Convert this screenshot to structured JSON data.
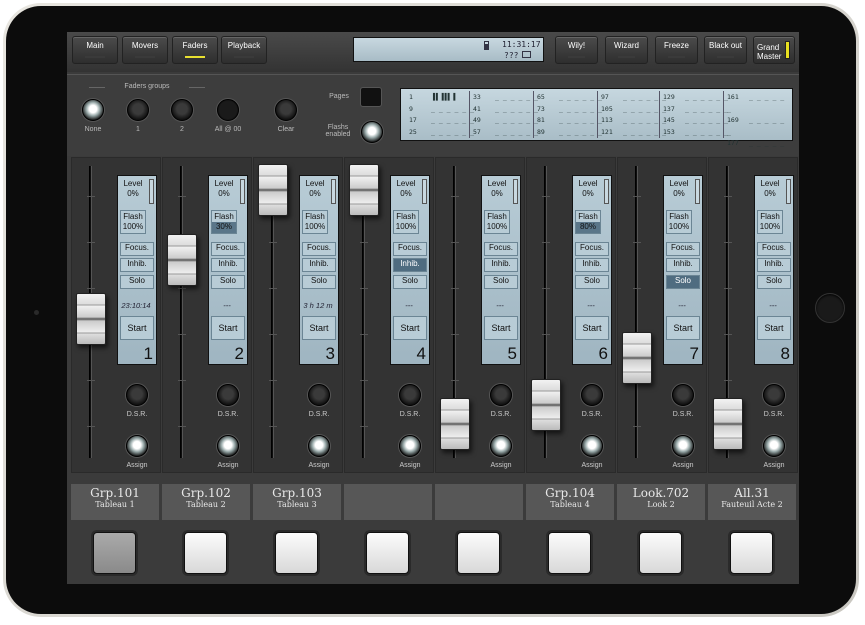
{
  "top_bar": {
    "buttons": [
      {
        "label": "Main",
        "active": false
      },
      {
        "label": "Movers",
        "active": false
      },
      {
        "label": "Faders",
        "active": true
      },
      {
        "label": "Playback",
        "active": false
      }
    ],
    "right_buttons": [
      "Wily!",
      "Wizard",
      "Freeze",
      "Black out"
    ],
    "grand_master": "Grand Master",
    "lcd": {
      "time": "11:31:17",
      "status": "???"
    }
  },
  "faders_groups": {
    "title": "Faders groups",
    "buttons": [
      {
        "label": "None",
        "lit": true
      },
      {
        "label": "1",
        "lit": false
      },
      {
        "label": "2",
        "lit": false
      },
      {
        "label": "All @ 00",
        "lit": false
      },
      {
        "label": "Clear",
        "lit": false
      }
    ],
    "pages_label": "Pages",
    "flashs_label": "Flashs enabled"
  },
  "pages_table": [
    [
      "1",
      "9",
      "17",
      "25"
    ],
    [
      "33",
      "41",
      "49",
      "57"
    ],
    [
      "65",
      "73",
      "81",
      "89"
    ],
    [
      "97",
      "105",
      "113",
      "121"
    ],
    [
      "129",
      "137",
      "145",
      "153"
    ],
    [
      "161",
      "169",
      "177",
      "185"
    ]
  ],
  "channels": [
    {
      "number": "1",
      "level_label": "Level",
      "level": "0%",
      "flash_label": "Flash",
      "flash": "100%",
      "focus": "Focus.",
      "inhib": "Inhib.",
      "solo": "Solo",
      "time": "23:10:14",
      "start": "Start",
      "dsr": "D.S.R.",
      "assign": "Assign",
      "fader_level": 0.45,
      "name": "Grp.101",
      "sub": "Tableau 1",
      "inhib_on": false,
      "solo_on": false
    },
    {
      "number": "2",
      "level_label": "Level",
      "level": "0%",
      "flash_label": "Flash",
      "flash": "30%",
      "focus": "Focus.",
      "inhib": "Inhib.",
      "solo": "Solo",
      "time": "---",
      "start": "Start",
      "dsr": "D.S.R.",
      "assign": "Assign",
      "fader_level": 0.7,
      "name": "Grp.102",
      "sub": "Tableau 2",
      "inhib_on": false,
      "solo_on": false
    },
    {
      "number": "3",
      "level_label": "Level",
      "level": "0%",
      "flash_label": "Flash",
      "flash": "100%",
      "focus": "Focus.",
      "inhib": "Inhib.",
      "solo": "Solo",
      "time": "3 h 12 m",
      "start": "Start",
      "dsr": "D.S.R.",
      "assign": "Assign",
      "fader_level": 1.0,
      "name": "Grp.103",
      "sub": "Tableau 3",
      "inhib_on": false,
      "solo_on": false
    },
    {
      "number": "4",
      "level_label": "Level",
      "level": "0%",
      "flash_label": "Flash",
      "flash": "100%",
      "focus": "Focus.",
      "inhib": "Inhib.",
      "solo": "Solo",
      "time": "---",
      "start": "Start",
      "dsr": "D.S.R.",
      "assign": "Assign",
      "fader_level": 1.0,
      "name": "",
      "sub": "",
      "inhib_on": true,
      "solo_on": false
    },
    {
      "number": "5",
      "level_label": "Level",
      "level": "0%",
      "flash_label": "Flash",
      "flash": "100%",
      "focus": "Focus.",
      "inhib": "Inhib.",
      "solo": "Solo",
      "time": "---",
      "start": "Start",
      "dsr": "D.S.R.",
      "assign": "Assign",
      "fader_level": 0.0,
      "name": "",
      "sub": "",
      "inhib_on": false,
      "solo_on": false
    },
    {
      "number": "6",
      "level_label": "Level",
      "level": "0%",
      "flash_label": "Flash",
      "flash": "80%",
      "focus": "Focus.",
      "inhib": "Inhib.",
      "solo": "Solo",
      "time": "---",
      "start": "Start",
      "dsr": "D.S.R.",
      "assign": "Assign",
      "fader_level": 0.08,
      "name": "Grp.104",
      "sub": "Tableau 4",
      "inhib_on": false,
      "solo_on": false
    },
    {
      "number": "7",
      "level_label": "Level",
      "level": "0%",
      "flash_label": "Flash",
      "flash": "100%",
      "focus": "Focus.",
      "inhib": "Inhib.",
      "solo": "Solo",
      "time": "---",
      "start": "Start",
      "dsr": "D.S.R.",
      "assign": "Assign",
      "fader_level": 0.28,
      "name": "Look.702",
      "sub": "Look 2",
      "inhib_on": false,
      "solo_on": true
    },
    {
      "number": "8",
      "level_label": "Level",
      "level": "0%",
      "flash_label": "Flash",
      "flash": "100%",
      "focus": "Focus.",
      "inhib": "Inhib.",
      "solo": "Solo",
      "time": "---",
      "start": "Start",
      "dsr": "D.S.R.",
      "assign": "Assign",
      "fader_level": 0.0,
      "name": "All.31",
      "sub": "Fauteuil Acte 2",
      "inhib_on": false,
      "solo_on": false
    }
  ],
  "flash_buttons_lit": [
    false,
    true,
    true,
    true,
    true,
    true,
    true,
    true
  ]
}
